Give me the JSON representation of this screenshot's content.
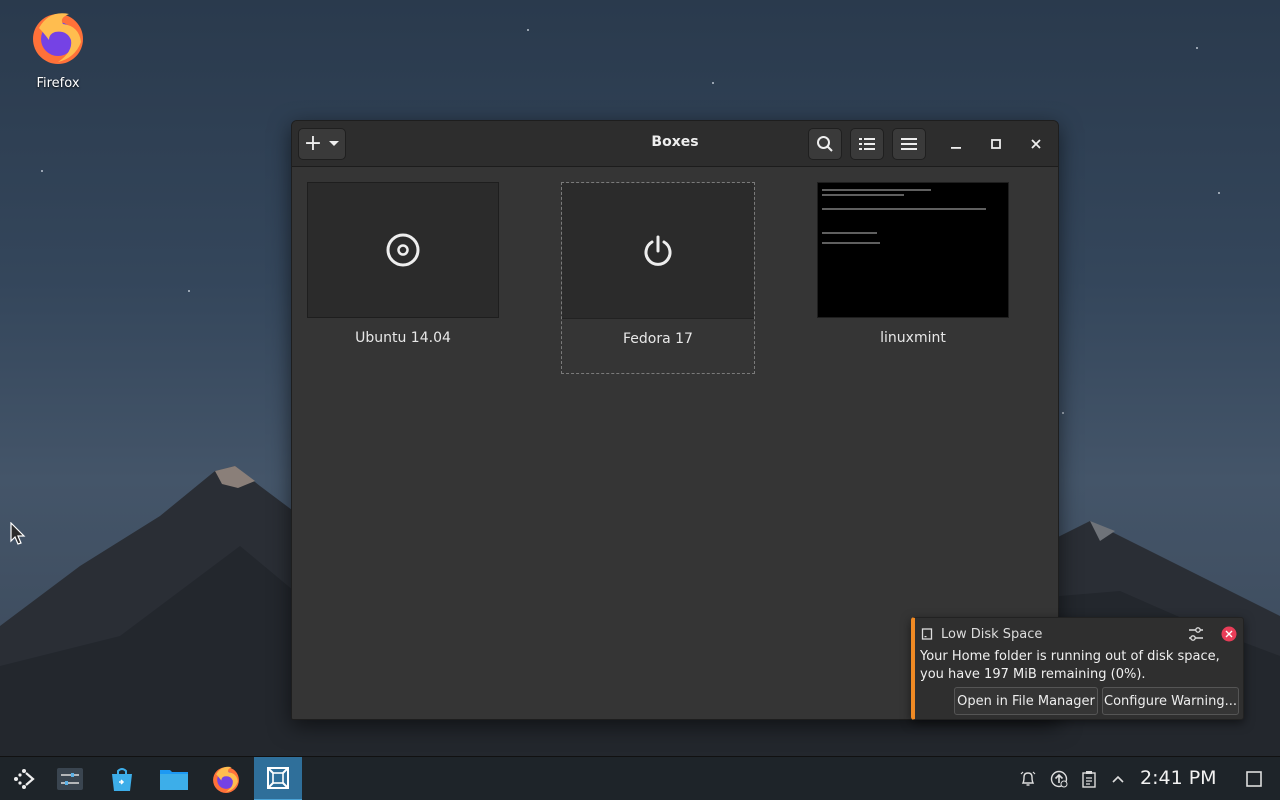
{
  "desktop": {
    "icons": [
      {
        "label": "Firefox",
        "icon": "firefox-icon"
      }
    ]
  },
  "window": {
    "title": "Boxes",
    "new_button": "+",
    "boxes": [
      {
        "name": "Ubuntu 14.04",
        "thumbnail": "cd-disc-icon"
      },
      {
        "name": "Fedora 17",
        "thumbnail": "power-icon",
        "selected": true
      },
      {
        "name": "linuxmint",
        "thumbnail": "console-screenshot"
      }
    ]
  },
  "notification": {
    "title": "Low Disk Space",
    "body_line1": "Your Home folder is running out of disk space,",
    "body_line2": "you have 197 MiB remaining (0%).",
    "open_button": "Open in File Manager",
    "configure_button": "Configure Warning...",
    "accent": "#f08a24"
  },
  "taskbar": {
    "items": [
      "application-launcher-icon",
      "system-settings-icon",
      "discover-store-icon",
      "file-manager-icon",
      "firefox-icon",
      "boxes-icon"
    ],
    "active_item": "boxes-icon",
    "tray": [
      "notifications-bell-icon",
      "updates-icon",
      "clipboard-icon",
      "show-hidden-arrow-icon"
    ],
    "clock": "2:41 PM"
  },
  "colors": {
    "accent_blue": "#2f6f9a",
    "window_bg": "#353535",
    "headerbar_bg": "#2d2d2d"
  }
}
